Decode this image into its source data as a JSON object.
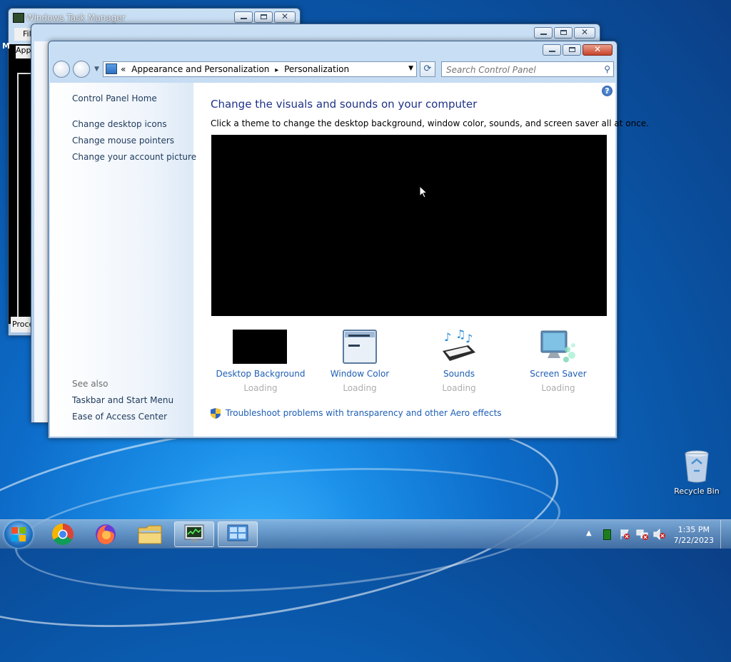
{
  "taskmgr": {
    "title": "Windows Task Manager",
    "menu_file": "File",
    "apps_tab": "App",
    "procs_tab": "Proce",
    "side_letter": "M"
  },
  "personalization": {
    "breadcrumb_prefix": "«",
    "breadcrumb_1": "Appearance and Personalization",
    "breadcrumb_sep": "▸",
    "breadcrumb_2": "Personalization",
    "search_placeholder": "Search Control Panel",
    "sidebar": {
      "home": "Control Panel Home",
      "links": [
        "Change desktop icons",
        "Change mouse pointers",
        "Change your account picture"
      ],
      "see_also_label": "See also",
      "see_also": [
        "Taskbar and Start Menu",
        "Ease of Access Center"
      ]
    },
    "heading": "Change the visuals and sounds on your computer",
    "description": "Click a theme to change the desktop background, window color, sounds, and screen saver all at once.",
    "tiles": [
      {
        "label": "Desktop Background",
        "status": "Loading"
      },
      {
        "label": "Window Color",
        "status": "Loading"
      },
      {
        "label": "Sounds",
        "status": "Loading"
      },
      {
        "label": "Screen Saver",
        "status": "Loading"
      }
    ],
    "troubleshoot": "Troubleshoot problems with transparency and other Aero effects",
    "help": "?"
  },
  "desktop": {
    "recycle_bin": "Recycle Bin"
  },
  "taskbar": {
    "time": "1:35 PM",
    "date": "7/22/2023",
    "apps": [
      "start-orb",
      "chrome-icon",
      "firefox-icon",
      "explorer-icon",
      "task-manager-icon",
      "control-panel-icon"
    ],
    "accent": "#1e5fb4"
  }
}
